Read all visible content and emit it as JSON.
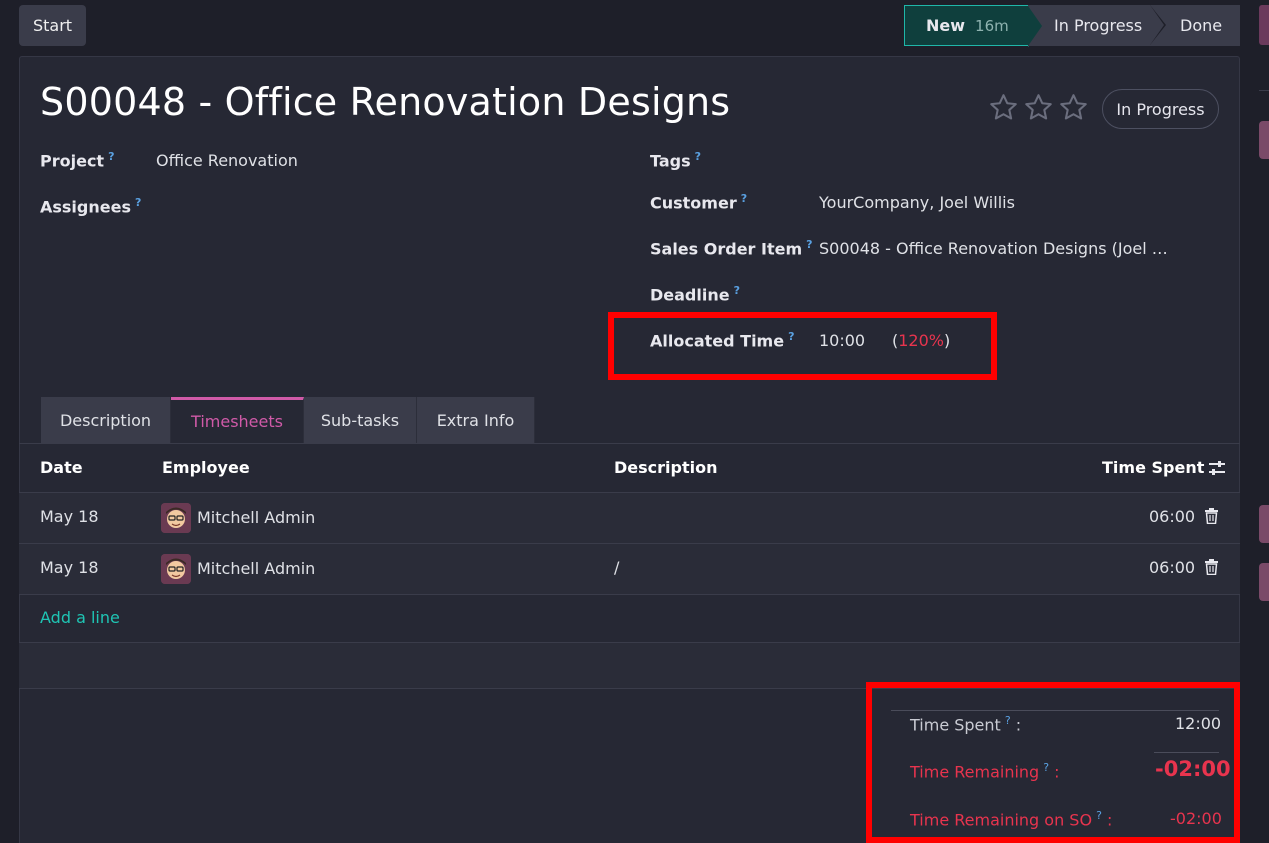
{
  "toolbar": {
    "start_label": "Start"
  },
  "stages": {
    "new_label": "New",
    "new_duration": "16m",
    "in_progress_label": "In Progress",
    "done_label": "Done"
  },
  "task": {
    "title": "S00048 - Office Renovation Designs",
    "state": "In Progress",
    "priority_stars": 3
  },
  "fields": {
    "project_label": "Project",
    "project_value": "Office Renovation",
    "assignees_label": "Assignees",
    "tags_label": "Tags",
    "customer_label": "Customer",
    "customer_value": "YourCompany, Joel Willis",
    "sales_order_item_label": "Sales Order Item",
    "sales_order_item_value": "S00048 - Office Renovation Designs (Joel …",
    "deadline_label": "Deadline",
    "allocated_time_label": "Allocated Time",
    "allocated_time_value": "10:00",
    "allocated_percent_open": "(",
    "allocated_percent": "120%",
    "allocated_percent_close": ")",
    "help_marker": "?"
  },
  "tabs": [
    {
      "label": "Description"
    },
    {
      "label": "Timesheets"
    },
    {
      "label": "Sub-tasks"
    },
    {
      "label": "Extra Info"
    }
  ],
  "timesheets": {
    "columns": {
      "date": "Date",
      "employee": "Employee",
      "description": "Description",
      "time_spent": "Time Spent"
    },
    "rows": [
      {
        "date": "May 18",
        "employee": "Mitchell Admin",
        "description": "",
        "time_spent": "06:00"
      },
      {
        "date": "May 18",
        "employee": "Mitchell Admin",
        "description": "/",
        "time_spent": "06:00"
      }
    ],
    "add_line_label": "Add a line"
  },
  "summary": {
    "time_spent_label": "Time Spent",
    "time_spent_value": "12:00",
    "time_remaining_label": "Time Remaining",
    "time_remaining_value": "-02:00",
    "time_remaining_so_label": "Time Remaining on SO",
    "time_remaining_so_value": "-02:00",
    "colon": ":"
  },
  "colors": {
    "accent_pink": "#d05aa8",
    "accent_teal": "#1fb7a9",
    "negative_red": "#e8344e",
    "highlight_box": "#ff0000"
  }
}
